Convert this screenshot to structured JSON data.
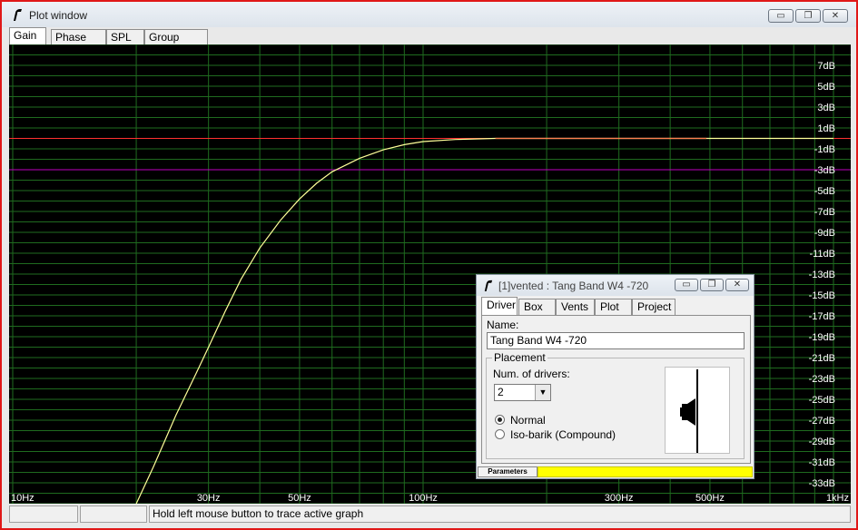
{
  "window": {
    "title": "Plot window",
    "controls": {
      "minimize": "▭",
      "restore": "❐",
      "close": "✕"
    }
  },
  "tabs": [
    {
      "label": "Gain",
      "active": true
    },
    {
      "label": "Phase plot",
      "active": false
    },
    {
      "label": "SPL",
      "active": false
    },
    {
      "label": "Group delay",
      "active": false
    }
  ],
  "colors": {
    "background": "#000000",
    "grid": "#1f6b1f",
    "curve": "#ffff99",
    "ref_red": "#ff3030",
    "ref_magenta": "#c000c0",
    "curve_highlight": "#ff7f50",
    "axis_text": "#ffffff"
  },
  "chart_data": {
    "type": "line",
    "title": "",
    "xlabel": "",
    "ylabel": "",
    "xscale": "log",
    "xlim": [
      10,
      1000
    ],
    "ylim": [
      -35,
      9
    ],
    "grid": true,
    "x_ticks": [
      {
        "value": 10,
        "label": "10Hz"
      },
      {
        "value": 30,
        "label": "30Hz"
      },
      {
        "value": 50,
        "label": "50Hz"
      },
      {
        "value": 100,
        "label": "100Hz"
      },
      {
        "value": 300,
        "label": "300Hz"
      },
      {
        "value": 500,
        "label": "500Hz"
      },
      {
        "value": 1000,
        "label": "1kHz"
      }
    ],
    "y_ticks": [
      {
        "value": 7,
        "label": "7dB"
      },
      {
        "value": 5,
        "label": "5dB"
      },
      {
        "value": 3,
        "label": "3dB"
      },
      {
        "value": 1,
        "label": "1dB"
      },
      {
        "value": -1,
        "label": "-1dB"
      },
      {
        "value": -3,
        "label": "-3dB"
      },
      {
        "value": -5,
        "label": "-5dB"
      },
      {
        "value": -7,
        "label": "-7dB"
      },
      {
        "value": -9,
        "label": "-9dB"
      },
      {
        "value": -11,
        "label": "-11dB"
      },
      {
        "value": -13,
        "label": "-13dB"
      },
      {
        "value": -15,
        "label": "-15dB"
      },
      {
        "value": -17,
        "label": "-17dB"
      },
      {
        "value": -19,
        "label": "-19dB"
      },
      {
        "value": -21,
        "label": "-21dB"
      },
      {
        "value": -23,
        "label": "-23dB"
      },
      {
        "value": -25,
        "label": "-25dB"
      },
      {
        "value": -27,
        "label": "-27dB"
      },
      {
        "value": -29,
        "label": "-29dB"
      },
      {
        "value": -31,
        "label": "-31dB"
      },
      {
        "value": -33,
        "label": "-33dB"
      }
    ],
    "reference_lines": [
      {
        "y": 0,
        "color": "#ff3030"
      },
      {
        "y": -3,
        "color": "#c000c0"
      }
    ],
    "series": [
      {
        "x": [
          20,
          22,
          25,
          28,
          30,
          33,
          36,
          40,
          45,
          50,
          55,
          60,
          70,
          80,
          90,
          100,
          120,
          150,
          200,
          250,
          300,
          400,
          490,
          600,
          800,
          1000
        ],
        "y": [
          -35,
          -31.5,
          -26.5,
          -22.5,
          -20,
          -16.5,
          -13.5,
          -10.5,
          -7.8,
          -5.8,
          -4.3,
          -3.2,
          -1.9,
          -1.1,
          -0.6,
          -0.3,
          -0.1,
          0,
          0,
          0,
          0,
          0,
          0,
          0,
          0,
          0
        ]
      }
    ]
  },
  "statusbar": {
    "cell1": "",
    "cell2": "",
    "message": "Hold left mouse button to trace active graph"
  },
  "dialog": {
    "title": "[1]vented : Tang Band W4 -720",
    "controls": {
      "minimize": "▭",
      "restore": "❐",
      "close": "✕"
    },
    "tabs": [
      {
        "label": "Driver",
        "active": true
      },
      {
        "label": "Box",
        "active": false
      },
      {
        "label": "Vents",
        "active": false
      },
      {
        "label": "Plot",
        "active": false
      },
      {
        "label": "Project",
        "active": false
      }
    ],
    "name_label": "Name:",
    "name_value": "Tang Band W4 -720",
    "placement": {
      "legend": "Placement",
      "num_drivers_label": "Num. of drivers:",
      "num_drivers_value": "2",
      "options": [
        {
          "label": "Normal",
          "selected": true
        },
        {
          "label": "Iso-barik (Compound)",
          "selected": false
        }
      ]
    },
    "status_left": "Parameters",
    "status_color": "#ffff00"
  }
}
